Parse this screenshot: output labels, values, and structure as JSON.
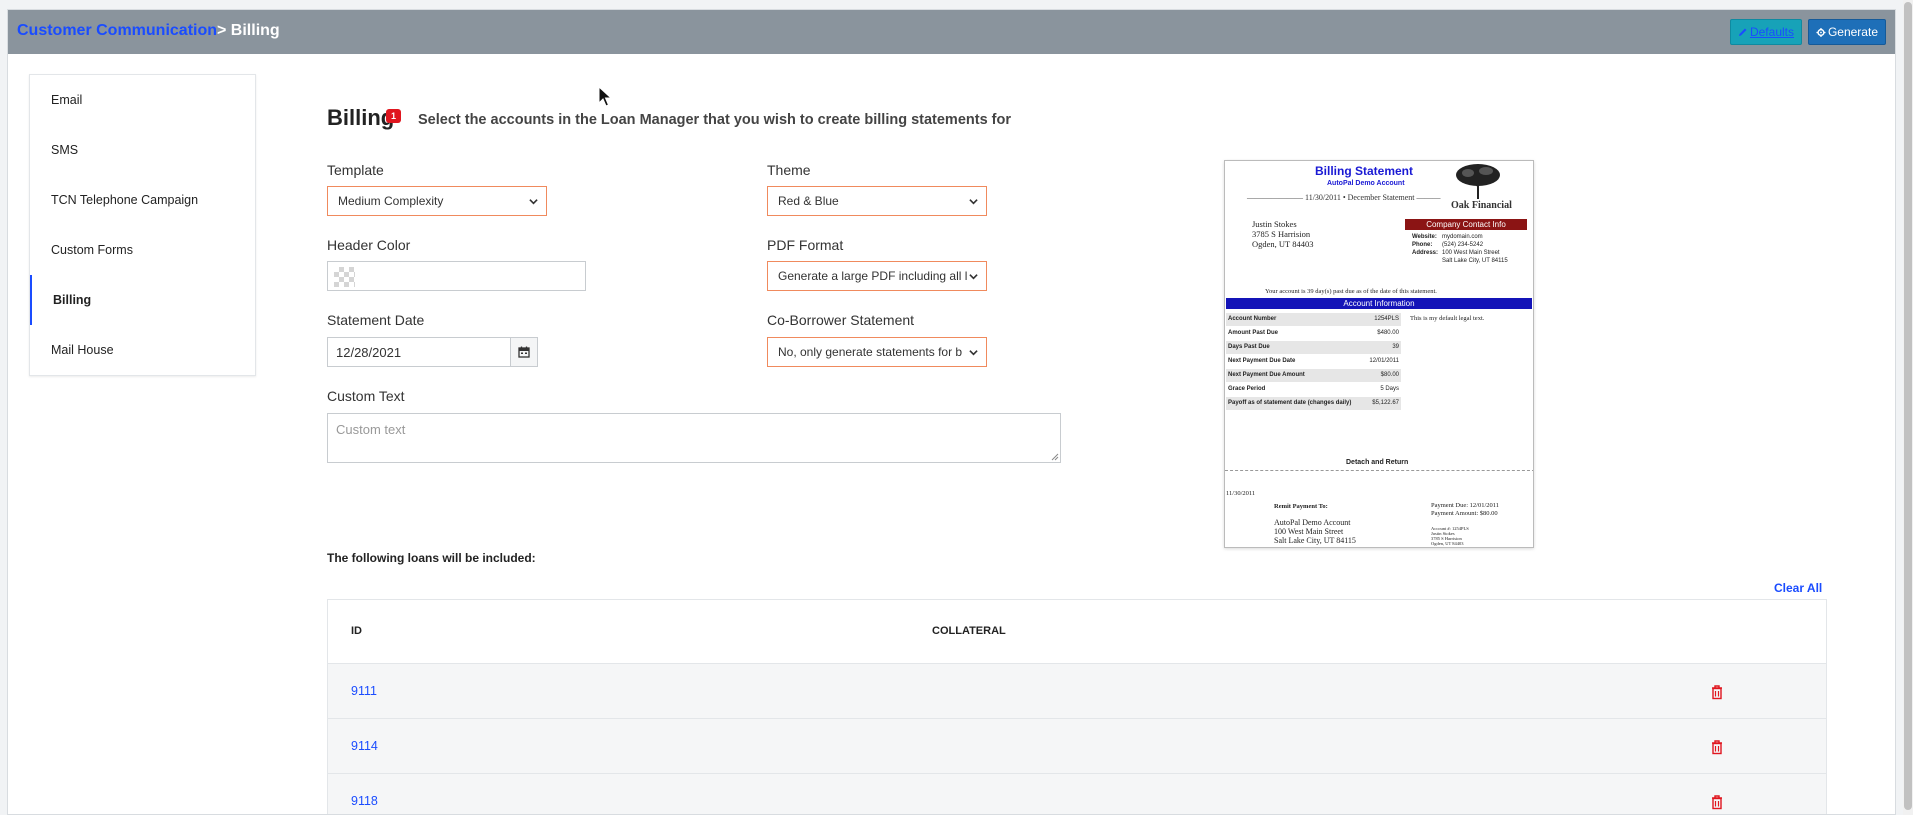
{
  "header": {
    "breadcrumb_parent": "Customer Communication",
    "breadcrumb_current": "> Billing",
    "defaults_label": "Defaults",
    "generate_label": "Generate"
  },
  "sidebar": {
    "items": [
      {
        "label": "Email"
      },
      {
        "label": "SMS"
      },
      {
        "label": "TCN Telephone Campaign"
      },
      {
        "label": "Custom Forms"
      },
      {
        "label": "Billing",
        "active": true
      },
      {
        "label": "Mail House"
      }
    ]
  },
  "page": {
    "title": "Billing",
    "badge": "1",
    "subtitle": "Select the accounts in the Loan Manager that you wish to create billing statements for"
  },
  "form": {
    "template_label": "Template",
    "template_value": "Medium Complexity",
    "theme_label": "Theme",
    "theme_value": "Red & Blue",
    "header_color_label": "Header Color",
    "header_color_value": "",
    "pdf_format_label": "PDF Format",
    "pdf_format_value": "Generate a large PDF including all l",
    "statement_date_label": "Statement Date",
    "statement_date_value": "12/28/2021",
    "coborrower_label": "Co-Borrower Statement",
    "coborrower_value": "No, only generate statements for b",
    "custom_text_label": "Custom Text",
    "custom_text_placeholder": "Custom text"
  },
  "preview": {
    "title": "Billing Statement",
    "subtitle": "AutoPal Demo Account",
    "date_line": "——————— 11/30/2011 • December Statement ———",
    "company": "Oak Financial",
    "customer_name": "Justin Stokes",
    "customer_street": "3785 S Harrision",
    "customer_city": "Ogden, UT 84403",
    "contact_header": "Company Contact Info",
    "website_label": "Website:",
    "website_value": "mydomain.com",
    "phone_label": "Phone:",
    "phone_value": "(524) 234-5242",
    "address_label": "Address:",
    "address_line1": "100 West Main Street",
    "address_line2": "Salt Lake City, UT 84115",
    "past_due_notice": "Your account is 39 day(s) past due as of the date of this statement.",
    "account_info_header": "Account Information",
    "rows": [
      {
        "k": "Account Number",
        "v": "1254PLS"
      },
      {
        "k": "Amount Past Due",
        "v": "$480.00"
      },
      {
        "k": "Days Past Due",
        "v": "39"
      },
      {
        "k": "Next Payment Due Date",
        "v": "12/01/2011"
      },
      {
        "k": "Next Payment Due Amount",
        "v": "$80.00"
      },
      {
        "k": "Grace Period",
        "v": "5 Days"
      },
      {
        "k": "Payoff as of statement date (changes daily)",
        "v": "$5,122.67"
      }
    ],
    "legal_text": "This is my default legal text.",
    "detach": "Detach and Return",
    "footer_date": "11/30/2011",
    "remit_label": "Remit Payment To:",
    "remit_name": "AutoPal Demo Account",
    "remit_street": "100 West Main Street",
    "remit_city": "Salt Lake City, UT 84115",
    "payment_due": "Payment Due: 12/01/2011",
    "payment_amount": "Payment Amount: $80.00",
    "stub_account": "Account #: 1254PLS",
    "stub_name": "Justin Stokes",
    "stub_street": "3785 S Harrision",
    "stub_city": "Ogden, UT 84403"
  },
  "loans": {
    "heading": "The following loans will be included:",
    "clear_all": "Clear All",
    "columns": [
      "ID",
      "COLLATERAL"
    ],
    "rows": [
      {
        "id": "9111",
        "collateral": ""
      },
      {
        "id": "9114",
        "collateral": ""
      },
      {
        "id": "9118",
        "collateral": ""
      }
    ]
  },
  "colors": {
    "accent_blue": "#1a4cff",
    "field_border": "#f08a5d",
    "header_bg": "#8a949d",
    "delete_red": "#e0161f"
  },
  "icons": {
    "defaults": "pencil-icon",
    "generate": "gears-icon",
    "calendar": "calendar-icon",
    "delete": "trash-icon",
    "dropdown": "chevron-down-icon"
  }
}
